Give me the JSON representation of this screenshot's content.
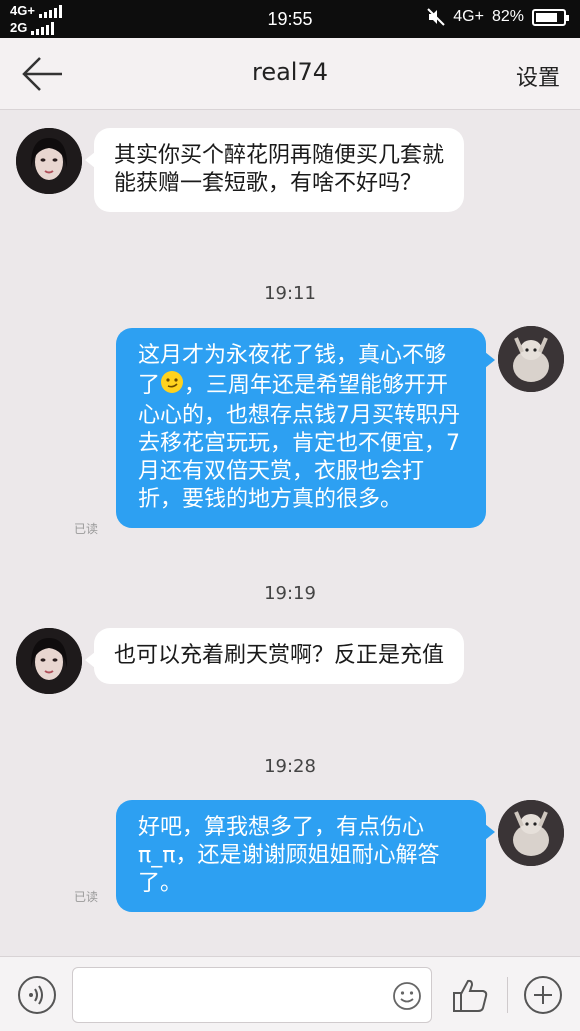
{
  "status_bar": {
    "network_top": "4G+",
    "network_bottom": "2G",
    "time": "19:55",
    "network_right": "4G+",
    "battery": "82%",
    "battery_level": 0.82
  },
  "header": {
    "title": "real74",
    "settings_label": "设置"
  },
  "messages": [
    {
      "sender": "other",
      "text": "其实你买个醉花阴再随便买几套就能获赠一套短歌，有啥不好吗？"
    },
    {
      "timestamp": "19:11"
    },
    {
      "sender": "me",
      "text_before_emoji": "这月才为永夜花了钱，真心不够了",
      "emoji": "smirk-emoji",
      "text_after_emoji": "，三周年还是希望能够开开心心的，也想存点钱7月买转职丹去移花宫玩玩，肯定也不便宜，7月还有双倍天赏，衣服也会打折，要钱的地方真的很多。",
      "read": "已读"
    },
    {
      "timestamp": "19:19"
    },
    {
      "sender": "other",
      "text": "也可以充着刷天赏啊？反正是充值"
    },
    {
      "timestamp": "19:28"
    },
    {
      "sender": "me",
      "text": "好吧，算我想多了，有点伤心π_π，还是谢谢顾姐姐耐心解答了。",
      "read": "已读"
    }
  ],
  "input": {
    "placeholder": ""
  },
  "colors": {
    "accent": "#2da0f2",
    "background": "#ece8ea",
    "incoming_bubble": "#ffffff"
  }
}
